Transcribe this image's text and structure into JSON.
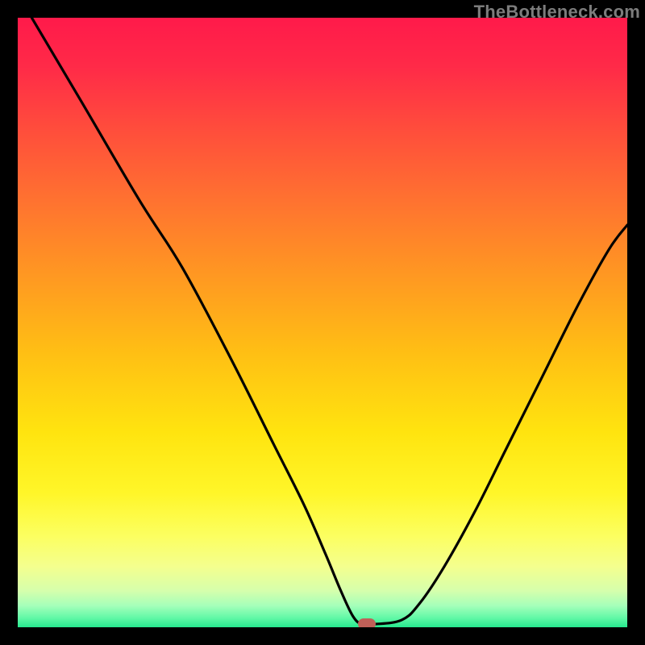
{
  "watermark": "TheBottleneck.com",
  "marker_color": "#c06058",
  "chart_data": {
    "type": "line",
    "title": "",
    "xlabel": "",
    "ylabel": "",
    "xlim": [
      0,
      100
    ],
    "ylim": [
      0,
      100
    ],
    "gradient_stops": [
      {
        "offset": 0.0,
        "color": "#ff1a4a"
      },
      {
        "offset": 0.08,
        "color": "#ff2a48"
      },
      {
        "offset": 0.18,
        "color": "#ff4c3c"
      },
      {
        "offset": 0.3,
        "color": "#ff7230"
      },
      {
        "offset": 0.42,
        "color": "#ff9722"
      },
      {
        "offset": 0.55,
        "color": "#ffbf14"
      },
      {
        "offset": 0.68,
        "color": "#ffe40f"
      },
      {
        "offset": 0.78,
        "color": "#fff629"
      },
      {
        "offset": 0.85,
        "color": "#fcff60"
      },
      {
        "offset": 0.9,
        "color": "#f4ff8e"
      },
      {
        "offset": 0.94,
        "color": "#d6ffac"
      },
      {
        "offset": 0.965,
        "color": "#a4ffba"
      },
      {
        "offset": 0.985,
        "color": "#60f8a6"
      },
      {
        "offset": 1.0,
        "color": "#26e88f"
      }
    ],
    "series": [
      {
        "name": "bottleneck-curve",
        "x": [
          2.3,
          10,
          20,
          27,
          35,
          42,
          47,
          50.5,
          53,
          55,
          56.5,
          58.5,
          63,
          66,
          70,
          75,
          80,
          86,
          92,
          97,
          100
        ],
        "y": [
          100,
          87,
          70,
          59,
          44,
          30,
          20,
          12,
          6,
          1.8,
          0.5,
          0.5,
          1.2,
          4,
          10,
          19,
          29,
          41,
          53,
          62,
          66
        ]
      }
    ],
    "marker": {
      "x": 57.3,
      "y": 0.5
    }
  }
}
